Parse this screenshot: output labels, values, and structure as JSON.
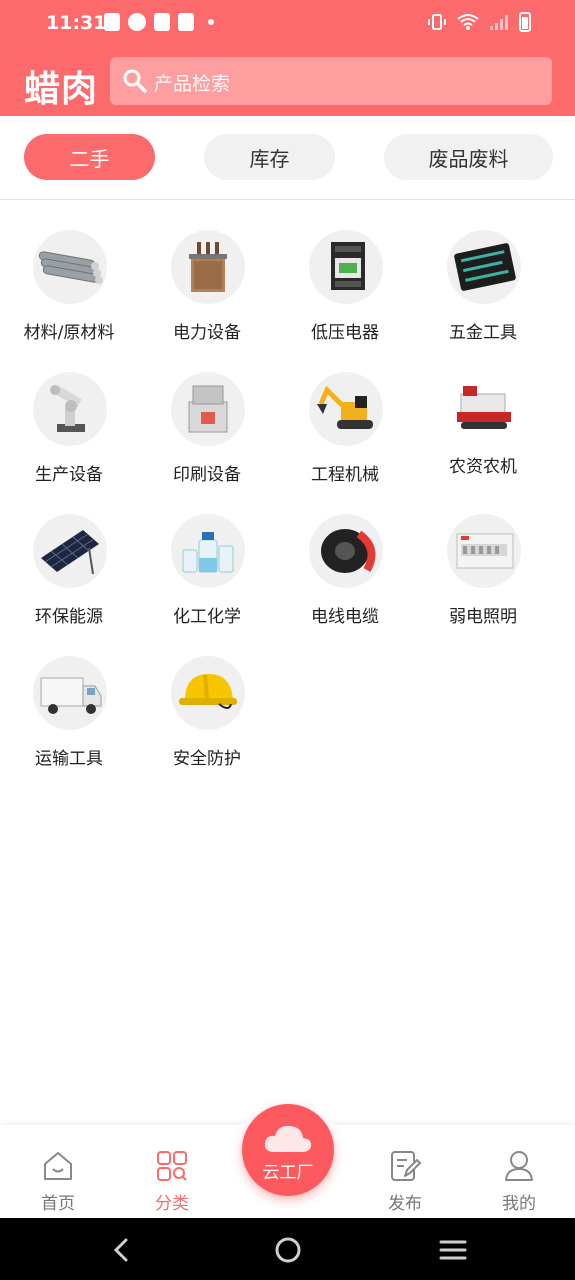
{
  "status_bar": {
    "time": "11:31"
  },
  "header": {
    "app_title": "蜡肉",
    "search_placeholder": "产品检索"
  },
  "tabs": [
    {
      "label": "二手",
      "active": true
    },
    {
      "label": "库存",
      "active": false
    },
    {
      "label": "废品废料",
      "active": false
    }
  ],
  "categories": [
    {
      "label": "材料/原材料",
      "icon": "steel-pipes-icon"
    },
    {
      "label": "电力设备",
      "icon": "transformer-icon"
    },
    {
      "label": "低压电器",
      "icon": "contactor-icon"
    },
    {
      "label": "五金工具",
      "icon": "toolkit-icon"
    },
    {
      "label": "生产设备",
      "icon": "robot-arm-icon"
    },
    {
      "label": "印刷设备",
      "icon": "printing-machine-icon"
    },
    {
      "label": "工程机械",
      "icon": "excavator-icon"
    },
    {
      "label": "农资农机",
      "icon": "harvester-icon"
    },
    {
      "label": "环保能源",
      "icon": "solar-panel-icon"
    },
    {
      "label": "化工化学",
      "icon": "chemical-bottles-icon"
    },
    {
      "label": "电线电缆",
      "icon": "cable-coil-icon"
    },
    {
      "label": "弱电照明",
      "icon": "distribution-box-icon"
    },
    {
      "label": "运输工具",
      "icon": "truck-icon"
    },
    {
      "label": "安全防护",
      "icon": "hard-hat-icon"
    }
  ],
  "bottom_nav": [
    {
      "label": "首页",
      "icon": "home-icon",
      "active": false
    },
    {
      "label": "分类",
      "icon": "category-icon",
      "active": true
    },
    {
      "label": "云工厂",
      "icon": "cloud-icon",
      "active": false
    },
    {
      "label": "发布",
      "icon": "edit-icon",
      "active": false
    },
    {
      "label": "我的",
      "icon": "user-icon",
      "active": false
    }
  ],
  "colors": {
    "accent": "#fd6a6c",
    "tab_inactive_bg": "#f1f1f1",
    "nav_inactive": "#777777"
  }
}
